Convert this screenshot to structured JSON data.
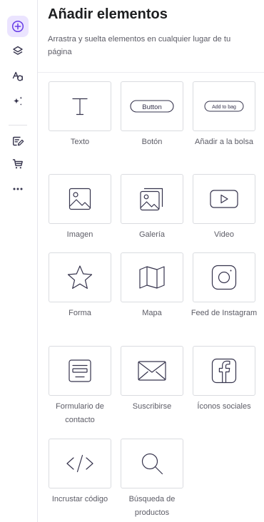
{
  "panel": {
    "title": "Añadir elementos",
    "subtitle": "Arrastra y suelta elementos en cualquier lugar de tu página"
  },
  "rail": {
    "items": [
      {
        "name": "add-elements",
        "icon": "plus-circle-icon",
        "active": true
      },
      {
        "name": "layers",
        "icon": "layers-icon",
        "active": false
      },
      {
        "name": "styles",
        "icon": "styles-icon",
        "active": false
      },
      {
        "name": "ai-tools",
        "icon": "sparkles-icon",
        "active": false
      },
      {
        "name": "blog",
        "icon": "blog-edit-icon",
        "active": false
      },
      {
        "name": "store",
        "icon": "cart-icon",
        "active": false
      },
      {
        "name": "more",
        "icon": "more-icon",
        "active": false
      }
    ]
  },
  "elements": [
    {
      "label": "Texto",
      "icon": "text-icon"
    },
    {
      "label": "Botón",
      "icon": "button-icon",
      "preview_text": "Button"
    },
    {
      "label": "Añadir a la bolsa",
      "icon": "add-to-bag-icon",
      "preview_text": "Add to bag"
    },
    {
      "label": "Imagen",
      "icon": "image-icon"
    },
    {
      "label": "Galería",
      "icon": "gallery-icon"
    },
    {
      "label": "Video",
      "icon": "video-icon"
    },
    {
      "label": "Forma",
      "icon": "star-shape-icon"
    },
    {
      "label": "Mapa",
      "icon": "map-icon"
    },
    {
      "label": "Feed de Instagram",
      "icon": "instagram-icon"
    },
    {
      "label": "Formulario de contacto",
      "icon": "contact-form-icon"
    },
    {
      "label": "Suscribirse",
      "icon": "envelope-icon"
    },
    {
      "label": "Íconos sociales",
      "icon": "facebook-icon"
    },
    {
      "label": "Incrustar código",
      "icon": "code-icon"
    },
    {
      "label": "Búsqueda de productos",
      "icon": "search-icon"
    }
  ],
  "colors": {
    "accent": "#673de6",
    "accent_bg": "#ebe4ff",
    "icon": "#36344d",
    "muted_text": "#5c5c66",
    "tile_border": "#dadce0"
  }
}
